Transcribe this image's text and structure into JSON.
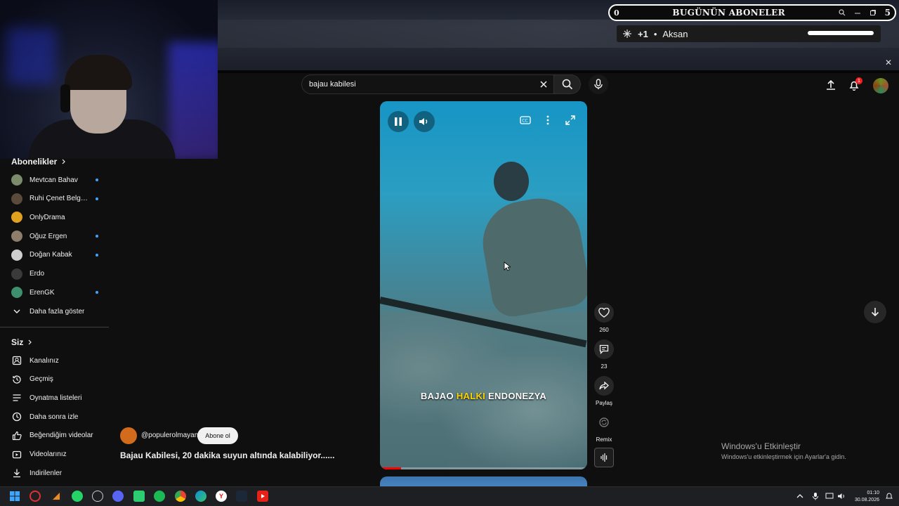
{
  "subscriber_widget": {
    "count": "0",
    "title": "BUGÜNÜN ABONELER",
    "right_number": "5",
    "latest": {
      "amount": "+1",
      "name": "Aksan"
    }
  },
  "search": {
    "query": "bajau kabilesi"
  },
  "header": {
    "notification_count": "1"
  },
  "sidebar": {
    "subscriptions_title": "Abonelikler",
    "subscriptions": [
      {
        "label": "Mevtcan Bahav",
        "new": true,
        "color": "#7c8c6a"
      },
      {
        "label": "Ruhi Çenet Belge...",
        "new": true,
        "color": "#5a4a3c"
      },
      {
        "label": "OnlyDrama",
        "new": false,
        "color": "#e0a020"
      },
      {
        "label": "Oğuz Ergen",
        "new": true,
        "color": "#8d7d6a"
      },
      {
        "label": "Doğan Kabak",
        "new": true,
        "color": "#cfcfcf"
      },
      {
        "label": "Erdo",
        "new": false,
        "color": "#3a3a3a"
      },
      {
        "label": "ErenGK",
        "new": true,
        "color": "#3d8f6d"
      }
    ],
    "show_more": "Daha fazla göster",
    "you_title": "Siz",
    "you_items": [
      {
        "label": "Kanalınız",
        "icon": "channel-icon"
      },
      {
        "label": "Geçmiş",
        "icon": "history-icon"
      },
      {
        "label": "Oynatma listeleri",
        "icon": "playlist-icon"
      },
      {
        "label": "Daha sonra izle",
        "icon": "clock-icon"
      },
      {
        "label": "Beğendiğim videolar",
        "icon": "thumbs-up-icon"
      },
      {
        "label": "Videolarınız",
        "icon": "video-icon"
      },
      {
        "label": "İndirilenler",
        "icon": "download-icon"
      }
    ]
  },
  "video": {
    "caption_part1": "BAJAO",
    "caption_highlight": "HALKI",
    "caption_part2": "ENDONEZYA",
    "progress": 0.1
  },
  "actions": {
    "likes": "260",
    "comments": "23",
    "share": "Paylaş",
    "remix": "Remix"
  },
  "short": {
    "channel": "@populerolmayan",
    "subscribe": "Abone ol",
    "title": "Bajau Kabilesi, 20 dakika suyun altında kalabiliyor......"
  },
  "windows": {
    "activate_title": "Windows'u Etkinleştir",
    "activate_sub": "Windows'u etkinleştirmek için Ayarlar'a gidin.",
    "time": "01:10",
    "date": "30.08.2026"
  },
  "colors": {
    "accent": "#3ea6ff",
    "caption_highlight": "#ffd400",
    "progress": "#ff0000"
  }
}
